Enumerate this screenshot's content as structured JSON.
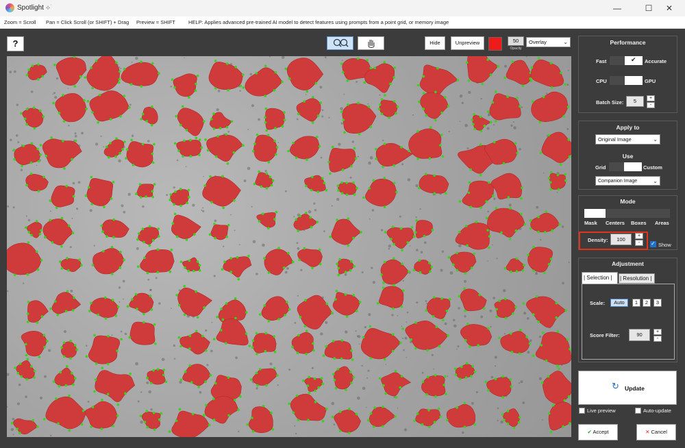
{
  "window": {
    "title": "Spotlight",
    "title_suffix": "⟡˙",
    "minimize": "—",
    "maximize": "☐",
    "close": "✕"
  },
  "helpbar": {
    "zoom": "Zoom = Scroll",
    "pan": "Pan = Click Scroll (or SHIFT) + Drag",
    "preview": "Preview = SHIFT",
    "help": "HELP:  Applies advanced pre-trained AI model to detect features using prompts from a point grid, or memory image"
  },
  "toolbar": {
    "help_label": "?",
    "zoom_tool_icon": "magnifier-icon",
    "pan_tool_icon": "hand-icon",
    "hide_label": "Hide",
    "unpreview_label": "Unpreview",
    "overlay_color": "#ee1b1b",
    "opacity_value": "50",
    "opacity_label": "Opacity",
    "display_mode": "Overlay"
  },
  "performance": {
    "title": "Performance",
    "fast_label": "Fast",
    "accurate_label": "Accurate",
    "cpu_label": "CPU",
    "gpu_label": "GPU",
    "batch_label": "Batch Size:",
    "batch_value": "5"
  },
  "apply_to": {
    "title": "Apply to",
    "selected": "Original Image",
    "use_label": "Use",
    "grid_label": "Grid",
    "custom_label": "Custom",
    "companion": "Companion Image"
  },
  "mode": {
    "title": "Mode",
    "options": [
      "Mask",
      "Centers",
      "Boxes",
      "Areas"
    ],
    "density_label": "Density:",
    "density_value": "100",
    "show_label": "Show"
  },
  "adjustment": {
    "title": "Adjustment",
    "tab_selection": "| Selection |",
    "tab_resolution": "| Resolution |",
    "scale_label": "Scale:",
    "scale_options": [
      "Auto",
      "1",
      "2",
      "3"
    ],
    "score_label": "Score Filter:",
    "score_value": "90"
  },
  "actions": {
    "update_label": "Update",
    "live_preview_label": "Live preview",
    "auto_update_label": "Auto-update",
    "accept_label": "Accept",
    "cancel_label": "Cancel"
  },
  "colors": {
    "mask_fill": "#cf3b3b",
    "point_color": "#39d11a",
    "background_image": "#a8a8a8",
    "panel_dark": "#3c3c3c"
  }
}
